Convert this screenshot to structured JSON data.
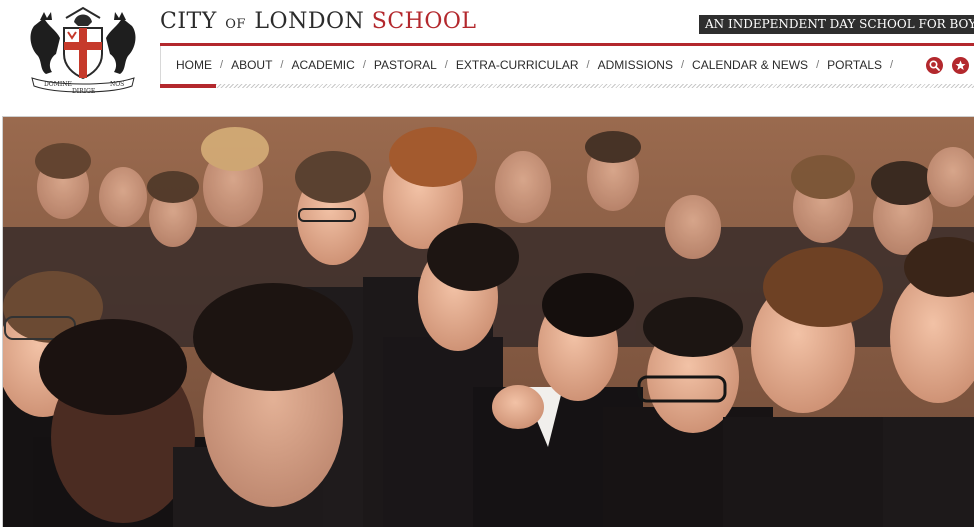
{
  "header": {
    "crest": {
      "motto_left": "DOMINE",
      "motto_right": "NOS",
      "motto_bottom": "DIRIGE"
    },
    "brand": {
      "word1": "CITY",
      "word2": "OF",
      "word3": "LONDON",
      "word4": "SCHOOL"
    },
    "tagline": "AN INDEPENDENT DAY SCHOOL FOR BOYS"
  },
  "nav": {
    "items": [
      {
        "label": "HOME"
      },
      {
        "label": "ABOUT"
      },
      {
        "label": "ACADEMIC"
      },
      {
        "label": "PASTORAL"
      },
      {
        "label": "EXTRA-CURRICULAR"
      },
      {
        "label": "ADMISSIONS"
      },
      {
        "label": "CALENDAR & NEWS"
      },
      {
        "label": "PORTALS"
      }
    ],
    "separator": "/",
    "icons": [
      "search-icon",
      "star-icon"
    ]
  },
  "colors": {
    "brand_red": "#b3282d",
    "dark": "#2e2e2e"
  },
  "hero": {
    "subject": "photo-assembly-students"
  }
}
